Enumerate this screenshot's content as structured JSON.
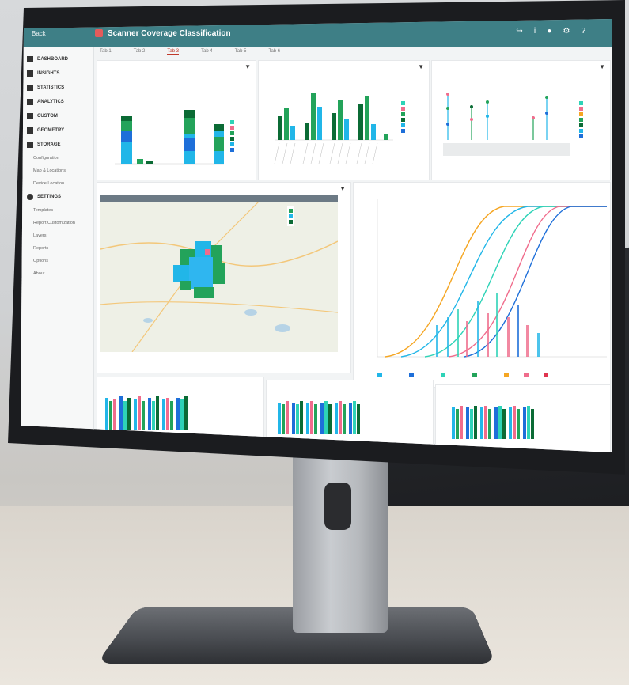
{
  "app": {
    "title": "Scanner Coverage Classification",
    "back_label": "Back",
    "topbar_icons": [
      "share-icon",
      "info-icon",
      "chat-icon",
      "settings-icon",
      "help-icon"
    ]
  },
  "sidebar": {
    "items": [
      {
        "label": "DASHBOARD",
        "icon": "dashboard-icon"
      },
      {
        "label": "INSIGHTS",
        "icon": "insights-icon"
      },
      {
        "label": "STATISTICS",
        "icon": "statistics-icon"
      },
      {
        "label": "ANALYTICS",
        "icon": "analytics-icon"
      },
      {
        "label": "CUSTOM",
        "icon": "custom-icon"
      },
      {
        "label": "GEOMETRY",
        "icon": "geometry-icon"
      },
      {
        "label": "STORAGE",
        "icon": "storage-icon"
      }
    ],
    "subitems": [
      "Configuration",
      "Map & Locations",
      "Device Location"
    ],
    "settings": {
      "label": "SETTINGS",
      "icon": "gear-icon"
    },
    "settings_sub": [
      "Templates",
      "Report Customization",
      "Layers",
      "Reports",
      "Options",
      "About"
    ]
  },
  "tabs": [
    "Tab 1",
    "Tab 2",
    "Tab 3",
    "Tab 4",
    "Tab 5",
    "Tab 6"
  ],
  "colors": {
    "topbar": "#3e7f86",
    "green": "#23a35a",
    "dark_green": "#0b6b35",
    "cyan": "#21b6e8",
    "blue": "#1e6fd9",
    "pink": "#f06c8c",
    "orange": "#f5a623",
    "teal": "#2ed3b7"
  }
}
